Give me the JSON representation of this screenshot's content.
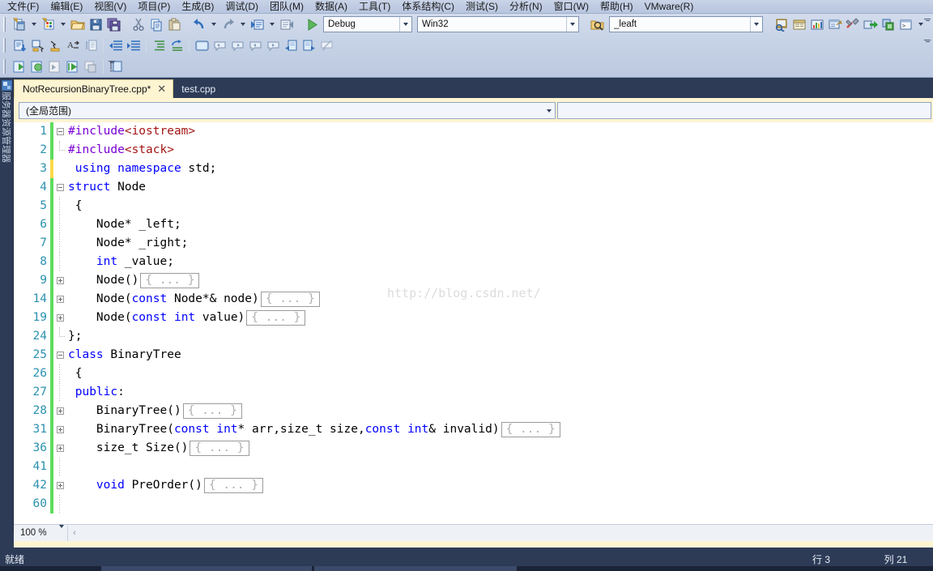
{
  "menu": {
    "items": [
      {
        "label": "文件(F)"
      },
      {
        "label": "编辑(E)"
      },
      {
        "label": "视图(V)"
      },
      {
        "label": "项目(P)"
      },
      {
        "label": "生成(B)"
      },
      {
        "label": "调试(D)"
      },
      {
        "label": "团队(M)"
      },
      {
        "label": "数据(A)"
      },
      {
        "label": "工具(T)"
      },
      {
        "label": "体系结构(C)"
      },
      {
        "label": "测试(S)"
      },
      {
        "label": "分析(N)"
      },
      {
        "label": "窗口(W)"
      },
      {
        "label": "帮助(H)"
      },
      {
        "label": "VMware(R)"
      }
    ]
  },
  "toolbar": {
    "config_value": "Debug",
    "platform_value": "Win32",
    "search_value": "_leaft",
    "icons_row1": [
      "new-project-icon",
      "new-item-icon",
      "open-file-icon",
      "save-icon",
      "save-all-icon",
      "cut-icon",
      "copy-icon",
      "paste-icon",
      "undo-icon",
      "redo-icon",
      "navigate-backward-icon",
      "navigate-forward-icon",
      "start-debug-icon"
    ],
    "icons_row1_right": [
      "find-in-files-icon",
      "properties-window-icon",
      "solution-explorer-icon",
      "object-browser-icon",
      "toolbox-icon",
      "output-window-icon",
      "error-list-icon",
      "command-window-icon"
    ],
    "icons_row2": [
      "insert-snippet-icon",
      "surround-with-icon",
      "comment-lines-icon",
      "uncomment-lines-icon",
      "toggle-outlining-icon",
      "decrease-indent-icon",
      "increase-indent-icon",
      "toggle-all-outlining-icon",
      "undo-outlining-icon",
      "toggle-bookmark-icon",
      "prev-bookmark-icon",
      "next-bookmark-icon",
      "prev-bookmark-folder-icon",
      "next-bookmark-folder-icon",
      "prev-bookmark-doc-icon",
      "next-bookmark-doc-icon",
      "clear-bookmarks-icon"
    ],
    "icons_row3": [
      "step-into-icon",
      "step-over-debug-icon",
      "step-out-icon",
      "run-to-cursor-icon",
      "show-next-statement-icon",
      "breakpoints-icon"
    ]
  },
  "leftdock": {
    "label": "服务器资源管理器",
    "icon": "server-explorer-icon"
  },
  "tabs": [
    {
      "label": "NotRecursionBinaryTree.cpp*",
      "active": true,
      "closable": true,
      "close_glyph": "✕"
    },
    {
      "label": "test.cpp",
      "active": false,
      "closable": false,
      "close_glyph": ""
    }
  ],
  "navbar": {
    "scope_value": "(全局范围)",
    "member_value": ""
  },
  "editor": {
    "watermark": "http://blog.csdn.net/",
    "lines": [
      {
        "num": "1",
        "change": "green",
        "outline": "box-minus",
        "guide": "none",
        "tokens": [
          {
            "t": "#include",
            "c": "pp"
          },
          {
            "t": "<iostream>",
            "c": "str"
          }
        ]
      },
      {
        "num": "2",
        "change": "green",
        "outline": "guide-elbow",
        "guide": "none",
        "tokens": [
          {
            "t": "#include",
            "c": "pp"
          },
          {
            "t": "<stack>",
            "c": "str"
          }
        ]
      },
      {
        "num": "3",
        "change": "yellow",
        "outline": "none",
        "guide": "none",
        "tokens": [
          {
            "t": " ",
            "c": "plain"
          },
          {
            "t": "using",
            "c": "kw"
          },
          {
            "t": " ",
            "c": "plain"
          },
          {
            "t": "namespace",
            "c": "kw"
          },
          {
            "t": " std;",
            "c": "plain"
          }
        ]
      },
      {
        "num": "4",
        "change": "green",
        "outline": "box-minus",
        "guide": "none",
        "tokens": [
          {
            "t": "struct",
            "c": "kw"
          },
          {
            "t": " Node",
            "c": "plain"
          }
        ]
      },
      {
        "num": "5",
        "change": "green",
        "outline": "guide-line",
        "guide": "none",
        "tokens": [
          {
            "t": " {",
            "c": "plain"
          }
        ]
      },
      {
        "num": "6",
        "change": "green",
        "outline": "guide-line",
        "guide": "none",
        "tokens": [
          {
            "t": "    Node* _left;",
            "c": "plain"
          }
        ]
      },
      {
        "num": "7",
        "change": "green",
        "outline": "guide-line",
        "guide": "none",
        "tokens": [
          {
            "t": "    Node* _right;",
            "c": "plain"
          }
        ]
      },
      {
        "num": "8",
        "change": "green",
        "outline": "guide-line",
        "guide": "none",
        "tokens": [
          {
            "t": "    ",
            "c": "plain"
          },
          {
            "t": "int",
            "c": "kw"
          },
          {
            "t": " _value;",
            "c": "plain"
          }
        ]
      },
      {
        "num": "9",
        "change": "green",
        "outline": "box-plus",
        "guide": "none",
        "tokens": [
          {
            "t": "    Node()",
            "c": "plain"
          }
        ],
        "collapsed": "{ ... }"
      },
      {
        "num": "14",
        "change": "green",
        "outline": "box-plus",
        "guide": "none",
        "tokens": [
          {
            "t": "    Node(",
            "c": "plain"
          },
          {
            "t": "const",
            "c": "kw"
          },
          {
            "t": " Node*& node)",
            "c": "plain"
          }
        ],
        "collapsed": "{ ... }"
      },
      {
        "num": "19",
        "change": "green",
        "outline": "box-plus",
        "guide": "none",
        "tokens": [
          {
            "t": "    Node(",
            "c": "plain"
          },
          {
            "t": "const",
            "c": "kw"
          },
          {
            "t": " ",
            "c": "plain"
          },
          {
            "t": "int",
            "c": "kw"
          },
          {
            "t": " value)",
            "c": "plain"
          }
        ],
        "collapsed": "{ ... }"
      },
      {
        "num": "24",
        "change": "green",
        "outline": "guide-elbow",
        "guide": "none",
        "tokens": [
          {
            "t": "};",
            "c": "plain"
          }
        ]
      },
      {
        "num": "25",
        "change": "green",
        "outline": "box-minus",
        "guide": "none",
        "tokens": [
          {
            "t": "class",
            "c": "kw"
          },
          {
            "t": " BinaryTree",
            "c": "plain"
          }
        ]
      },
      {
        "num": "26",
        "change": "green",
        "outline": "guide-line",
        "guide": "none",
        "tokens": [
          {
            "t": " {",
            "c": "plain"
          }
        ]
      },
      {
        "num": "27",
        "change": "green",
        "outline": "guide-line",
        "guide": "none",
        "tokens": [
          {
            "t": " ",
            "c": "plain"
          },
          {
            "t": "public",
            "c": "kw"
          },
          {
            "t": ":",
            "c": "plain"
          }
        ]
      },
      {
        "num": "28",
        "change": "green",
        "outline": "box-plus",
        "guide": "none",
        "tokens": [
          {
            "t": "    BinaryTree()",
            "c": "plain"
          }
        ],
        "collapsed": "{ ... }"
      },
      {
        "num": "31",
        "change": "green",
        "outline": "box-plus",
        "guide": "none",
        "tokens": [
          {
            "t": "    BinaryTree(",
            "c": "plain"
          },
          {
            "t": "const",
            "c": "kw"
          },
          {
            "t": " ",
            "c": "plain"
          },
          {
            "t": "int",
            "c": "kw"
          },
          {
            "t": "* arr,size_t size,",
            "c": "plain"
          },
          {
            "t": "const",
            "c": "kw"
          },
          {
            "t": " ",
            "c": "plain"
          },
          {
            "t": "int",
            "c": "kw"
          },
          {
            "t": "& invalid)",
            "c": "plain"
          }
        ],
        "collapsed": "{ ... }"
      },
      {
        "num": "36",
        "change": "green",
        "outline": "box-plus",
        "guide": "none",
        "tokens": [
          {
            "t": "    size_t Size()",
            "c": "plain"
          }
        ],
        "collapsed": "{ ... }"
      },
      {
        "num": "41",
        "change": "green",
        "outline": "guide-line",
        "guide": "none",
        "tokens": [
          {
            "t": "",
            "c": "plain"
          }
        ]
      },
      {
        "num": "42",
        "change": "green",
        "outline": "box-plus",
        "guide": "none",
        "tokens": [
          {
            "t": "    ",
            "c": "plain"
          },
          {
            "t": "void",
            "c": "kw"
          },
          {
            "t": " PreOrder()",
            "c": "plain"
          }
        ],
        "collapsed": "{ ... }"
      },
      {
        "num": "60",
        "change": "green",
        "outline": "guide-line",
        "guide": "none",
        "tokens": [
          {
            "t": "",
            "c": "plain"
          }
        ]
      }
    ]
  },
  "hscroll": {
    "zoom_value": "100 %",
    "left_arrow": "‹"
  },
  "statusbar": {
    "message": "就绪",
    "line_label": "行 3",
    "col_label": "列 21"
  }
}
